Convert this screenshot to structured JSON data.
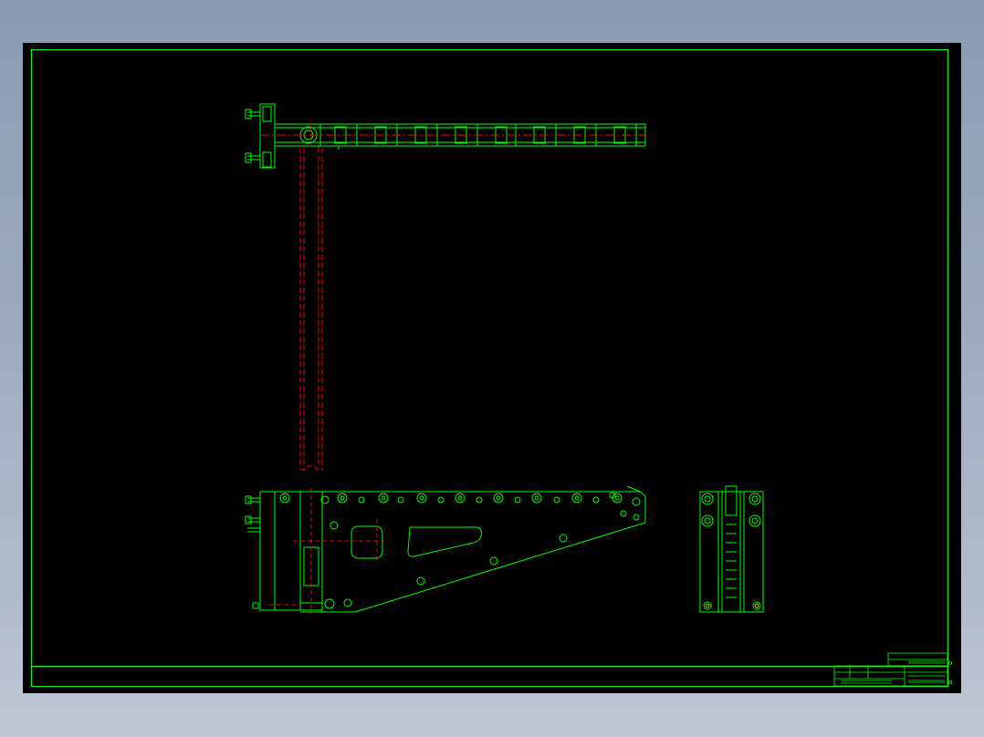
{
  "drawing": {
    "colors": {
      "background": "#000000",
      "outline": "#00ff00",
      "hidden": "#ff0000",
      "accent": "#ffff00"
    },
    "views": [
      {
        "name": "top-view"
      },
      {
        "name": "front-view"
      },
      {
        "name": "side-view"
      }
    ]
  }
}
